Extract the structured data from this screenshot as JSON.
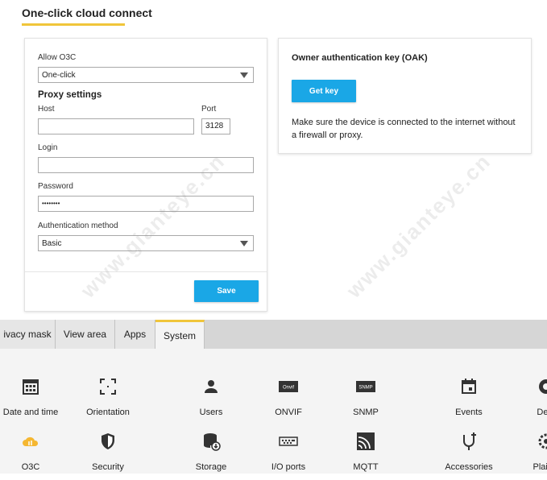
{
  "page": {
    "title": "One-click cloud connect"
  },
  "form": {
    "allow_o3c_label": "Allow O3C",
    "allow_o3c_value": "One-click",
    "proxy_heading": "Proxy settings",
    "host_label": "Host",
    "host_value": "",
    "port_label": "Port",
    "port_value": "3128",
    "login_label": "Login",
    "login_value": "",
    "password_label": "Password",
    "password_value": "••••••••",
    "auth_label": "Authentication method",
    "auth_value": "Basic",
    "save_label": "Save"
  },
  "oak": {
    "title": "Owner authentication key (OAK)",
    "button_label": "Get key",
    "note": "Make sure the device is connected to the internet without a firewall or proxy."
  },
  "tabs": [
    {
      "label": "ivacy mask",
      "active": false
    },
    {
      "label": "View area",
      "active": false
    },
    {
      "label": "Apps",
      "active": false
    },
    {
      "label": "System",
      "active": true
    }
  ],
  "system_items": [
    {
      "label": "Date and time",
      "icon": "calendar-icon"
    },
    {
      "label": "Orientation",
      "icon": "orientation-icon"
    },
    {
      "label": "Users",
      "icon": "user-icon"
    },
    {
      "label": "ONVIF",
      "icon": "onvif-icon"
    },
    {
      "label": "SNMP",
      "icon": "snmp-icon"
    },
    {
      "label": "Events",
      "icon": "events-icon"
    },
    {
      "label": "Dete",
      "icon": "detectors-icon"
    },
    {
      "label": "O3C",
      "icon": "cloud-icon"
    },
    {
      "label": "Security",
      "icon": "shield-icon"
    },
    {
      "label": "Storage",
      "icon": "storage-icon"
    },
    {
      "label": "I/O ports",
      "icon": "io-ports-icon"
    },
    {
      "label": "MQTT",
      "icon": "mqtt-icon"
    },
    {
      "label": "Accessories",
      "icon": "accessories-icon"
    },
    {
      "label": "Plain c",
      "icon": "plain-config-icon"
    }
  ],
  "icon_texts": {
    "onvif": "Onvif",
    "snmp": "SNMP"
  },
  "colors": {
    "accent": "#f0c53a",
    "button": "#1aa7e6",
    "o3c_icon": "#f5b731"
  },
  "watermark": "www.gianteye.cn"
}
